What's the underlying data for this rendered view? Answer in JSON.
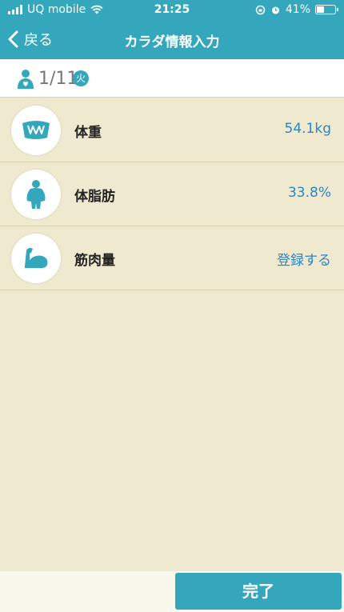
{
  "status_bar": {
    "carrier": "UQ mobile",
    "time": "21:25",
    "battery": "41%",
    "battery_level": 0.41
  },
  "nav": {
    "back_label": "戻る",
    "title": "カラダ情報入力"
  },
  "date_bar": {
    "date": "1/11",
    "weekday": "火"
  },
  "rows": [
    {
      "label": "体重",
      "value": "54.1kg",
      "icon": "scale-icon"
    },
    {
      "label": "体脂肪",
      "value": "33.8%",
      "icon": "body-fat-icon"
    },
    {
      "label": "筋肉量",
      "value": "登録する",
      "icon": "muscle-arm-icon"
    }
  ],
  "footer": {
    "done_label": "完了"
  },
  "colors": {
    "accent": "#34a7bd",
    "background": "#efe9cf",
    "value_text": "#2a86c9"
  }
}
